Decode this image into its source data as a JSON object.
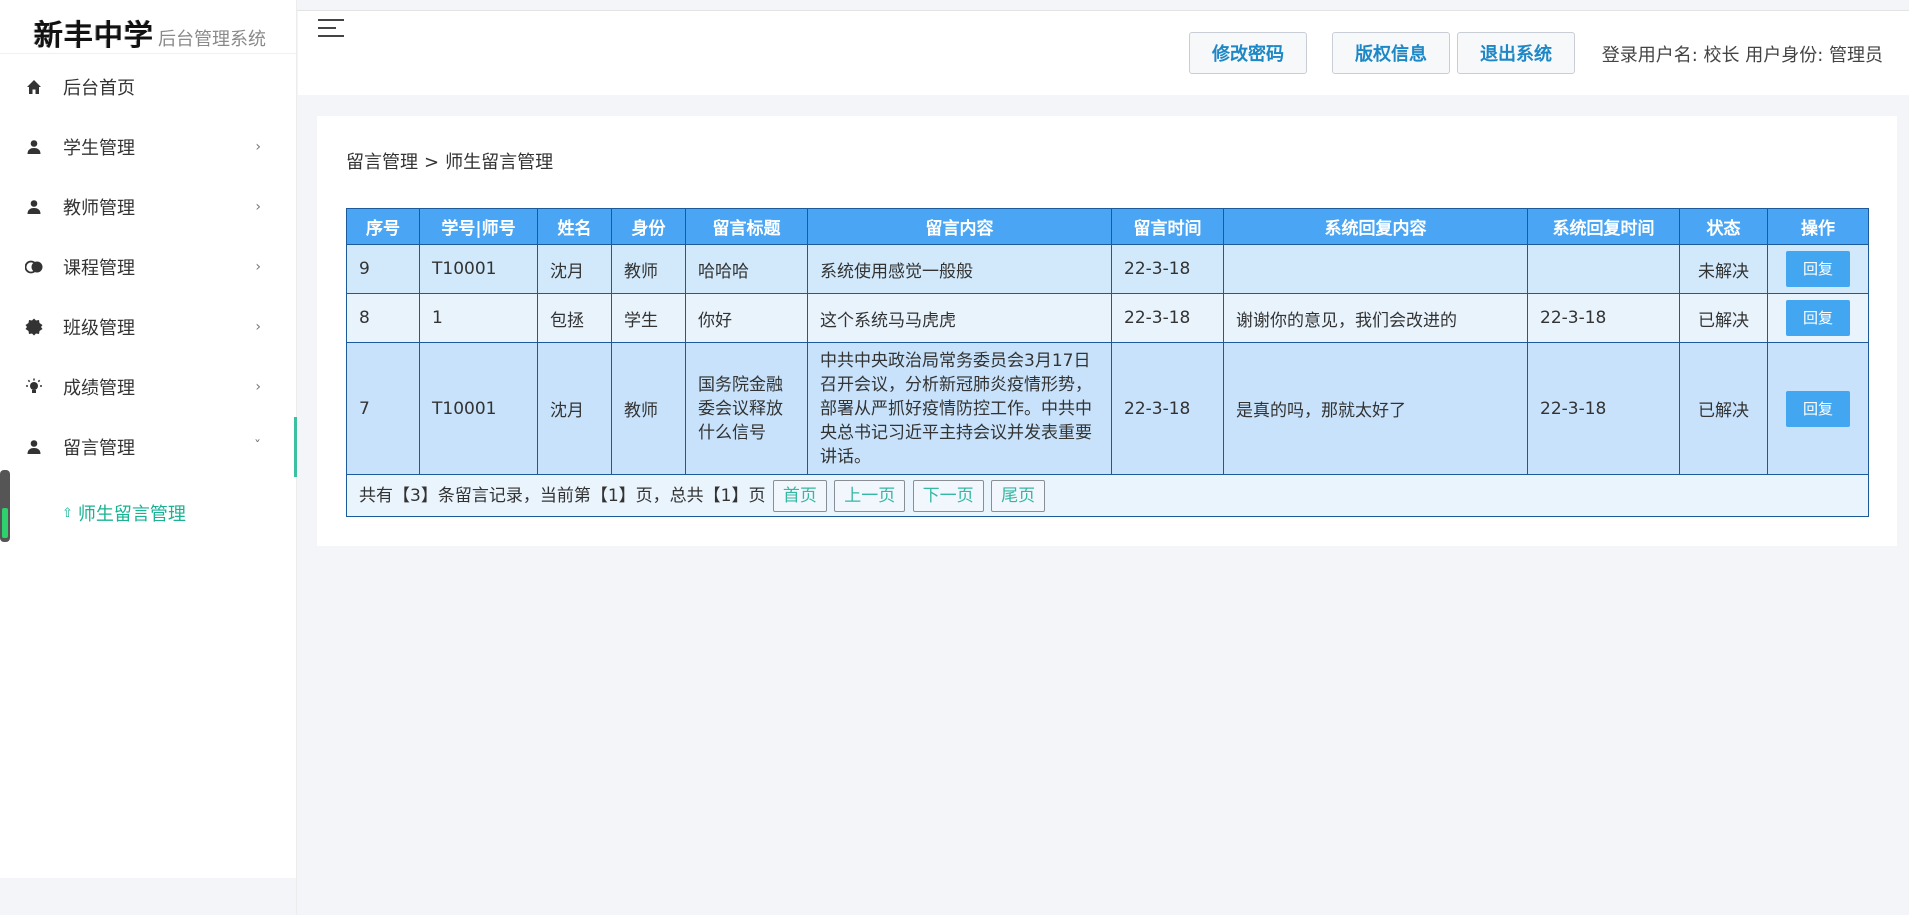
{
  "brand": {
    "school": "新丰中学",
    "system": "后台管理系统"
  },
  "sidebar": {
    "items": [
      {
        "label": "后台首页",
        "icon": "home-icon",
        "has_arrow": false
      },
      {
        "label": "学生管理",
        "icon": "user-icon",
        "has_arrow": true
      },
      {
        "label": "教师管理",
        "icon": "user-icon",
        "has_arrow": true
      },
      {
        "label": "课程管理",
        "icon": "toggle-icon",
        "has_arrow": true
      },
      {
        "label": "班级管理",
        "icon": "gear-icon",
        "has_arrow": true
      },
      {
        "label": "成绩管理",
        "icon": "bulb-icon",
        "has_arrow": true
      },
      {
        "label": "留言管理",
        "icon": "user-icon",
        "has_arrow": true,
        "expanded": true
      }
    ],
    "submenu": {
      "label": "师生留言管理"
    },
    "arrow_right": "›",
    "arrow_down": "ˇ"
  },
  "header": {
    "buttons": {
      "change_password": "修改密码",
      "copyright": "版权信息",
      "logout": "退出系统"
    },
    "userinfo": "登录用户名:  校长 用户身份:  管理员"
  },
  "breadcrumb": {
    "parent": "留言管理",
    "sep": ">",
    "current": "师生留言管理"
  },
  "table": {
    "headers": [
      "序号",
      "学号|师号",
      "姓名",
      "身份",
      "留言标题",
      "留言内容",
      "留言时间",
      "系统回复内容",
      "系统回复时间",
      "状态",
      "操作"
    ],
    "rows": [
      {
        "id": "9",
        "num": "T10001",
        "name": "沈月",
        "role": "教师",
        "title": "哈哈哈",
        "content": "系统使用感觉一般般",
        "time": "22-3-18",
        "reply": "",
        "reply_time": "",
        "status": "未解决",
        "resolved": false,
        "action": "回复"
      },
      {
        "id": "8",
        "num": "1",
        "name": "包拯",
        "role": "学生",
        "title": "你好",
        "content": "这个系统马马虎虎",
        "time": "22-3-18",
        "reply": "谢谢你的意见，我们会改进的",
        "reply_time": "22-3-18",
        "status": "已解决",
        "resolved": true,
        "action": "回复"
      },
      {
        "id": "7",
        "num": "T10001",
        "name": "沈月",
        "role": "教师",
        "title": "国务院金融委会议释放什么信号",
        "content": "中共中央政治局常务委员会3月17日召开会议，分析新冠肺炎疫情形势，部署从严抓好疫情防控工作。中共中央总书记习近平主持会议并发表重要讲话。",
        "time": "22-3-18",
        "reply": "是真的吗，那就太好了",
        "reply_time": "22-3-18",
        "status": "已解决",
        "resolved": true,
        "action": "回复"
      }
    ]
  },
  "pager": {
    "summary": "共有【3】条留言记录，当前第【1】页，总共【1】页",
    "first": "首页",
    "prev": "上一页",
    "next": "下一页",
    "last": "尾页"
  },
  "colors": {
    "header_blue": "#4aa6f5",
    "accent_green": "#19b393",
    "unresolved": "#f25555",
    "resolved": "#19b36e",
    "button_text": "#1e88c7"
  }
}
